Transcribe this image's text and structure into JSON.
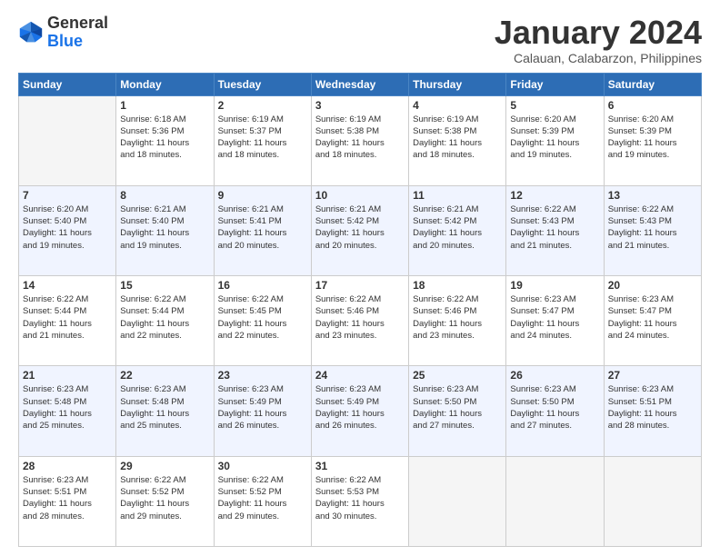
{
  "logo": {
    "line1": "General",
    "line2": "Blue"
  },
  "title": "January 2024",
  "subtitle": "Calauan, Calabarzon, Philippines",
  "days_of_week": [
    "Sunday",
    "Monday",
    "Tuesday",
    "Wednesday",
    "Thursday",
    "Friday",
    "Saturday"
  ],
  "weeks": [
    [
      {
        "num": "",
        "sunrise": "",
        "sunset": "",
        "daylight": ""
      },
      {
        "num": "1",
        "sunrise": "Sunrise: 6:18 AM",
        "sunset": "Sunset: 5:36 PM",
        "daylight": "Daylight: 11 hours and 18 minutes."
      },
      {
        "num": "2",
        "sunrise": "Sunrise: 6:19 AM",
        "sunset": "Sunset: 5:37 PM",
        "daylight": "Daylight: 11 hours and 18 minutes."
      },
      {
        "num": "3",
        "sunrise": "Sunrise: 6:19 AM",
        "sunset": "Sunset: 5:38 PM",
        "daylight": "Daylight: 11 hours and 18 minutes."
      },
      {
        "num": "4",
        "sunrise": "Sunrise: 6:19 AM",
        "sunset": "Sunset: 5:38 PM",
        "daylight": "Daylight: 11 hours and 18 minutes."
      },
      {
        "num": "5",
        "sunrise": "Sunrise: 6:20 AM",
        "sunset": "Sunset: 5:39 PM",
        "daylight": "Daylight: 11 hours and 19 minutes."
      },
      {
        "num": "6",
        "sunrise": "Sunrise: 6:20 AM",
        "sunset": "Sunset: 5:39 PM",
        "daylight": "Daylight: 11 hours and 19 minutes."
      }
    ],
    [
      {
        "num": "7",
        "sunrise": "Sunrise: 6:20 AM",
        "sunset": "Sunset: 5:40 PM",
        "daylight": "Daylight: 11 hours and 19 minutes."
      },
      {
        "num": "8",
        "sunrise": "Sunrise: 6:21 AM",
        "sunset": "Sunset: 5:40 PM",
        "daylight": "Daylight: 11 hours and 19 minutes."
      },
      {
        "num": "9",
        "sunrise": "Sunrise: 6:21 AM",
        "sunset": "Sunset: 5:41 PM",
        "daylight": "Daylight: 11 hours and 20 minutes."
      },
      {
        "num": "10",
        "sunrise": "Sunrise: 6:21 AM",
        "sunset": "Sunset: 5:42 PM",
        "daylight": "Daylight: 11 hours and 20 minutes."
      },
      {
        "num": "11",
        "sunrise": "Sunrise: 6:21 AM",
        "sunset": "Sunset: 5:42 PM",
        "daylight": "Daylight: 11 hours and 20 minutes."
      },
      {
        "num": "12",
        "sunrise": "Sunrise: 6:22 AM",
        "sunset": "Sunset: 5:43 PM",
        "daylight": "Daylight: 11 hours and 21 minutes."
      },
      {
        "num": "13",
        "sunrise": "Sunrise: 6:22 AM",
        "sunset": "Sunset: 5:43 PM",
        "daylight": "Daylight: 11 hours and 21 minutes."
      }
    ],
    [
      {
        "num": "14",
        "sunrise": "Sunrise: 6:22 AM",
        "sunset": "Sunset: 5:44 PM",
        "daylight": "Daylight: 11 hours and 21 minutes."
      },
      {
        "num": "15",
        "sunrise": "Sunrise: 6:22 AM",
        "sunset": "Sunset: 5:44 PM",
        "daylight": "Daylight: 11 hours and 22 minutes."
      },
      {
        "num": "16",
        "sunrise": "Sunrise: 6:22 AM",
        "sunset": "Sunset: 5:45 PM",
        "daylight": "Daylight: 11 hours and 22 minutes."
      },
      {
        "num": "17",
        "sunrise": "Sunrise: 6:22 AM",
        "sunset": "Sunset: 5:46 PM",
        "daylight": "Daylight: 11 hours and 23 minutes."
      },
      {
        "num": "18",
        "sunrise": "Sunrise: 6:22 AM",
        "sunset": "Sunset: 5:46 PM",
        "daylight": "Daylight: 11 hours and 23 minutes."
      },
      {
        "num": "19",
        "sunrise": "Sunrise: 6:23 AM",
        "sunset": "Sunset: 5:47 PM",
        "daylight": "Daylight: 11 hours and 24 minutes."
      },
      {
        "num": "20",
        "sunrise": "Sunrise: 6:23 AM",
        "sunset": "Sunset: 5:47 PM",
        "daylight": "Daylight: 11 hours and 24 minutes."
      }
    ],
    [
      {
        "num": "21",
        "sunrise": "Sunrise: 6:23 AM",
        "sunset": "Sunset: 5:48 PM",
        "daylight": "Daylight: 11 hours and 25 minutes."
      },
      {
        "num": "22",
        "sunrise": "Sunrise: 6:23 AM",
        "sunset": "Sunset: 5:48 PM",
        "daylight": "Daylight: 11 hours and 25 minutes."
      },
      {
        "num": "23",
        "sunrise": "Sunrise: 6:23 AM",
        "sunset": "Sunset: 5:49 PM",
        "daylight": "Daylight: 11 hours and 26 minutes."
      },
      {
        "num": "24",
        "sunrise": "Sunrise: 6:23 AM",
        "sunset": "Sunset: 5:49 PM",
        "daylight": "Daylight: 11 hours and 26 minutes."
      },
      {
        "num": "25",
        "sunrise": "Sunrise: 6:23 AM",
        "sunset": "Sunset: 5:50 PM",
        "daylight": "Daylight: 11 hours and 27 minutes."
      },
      {
        "num": "26",
        "sunrise": "Sunrise: 6:23 AM",
        "sunset": "Sunset: 5:50 PM",
        "daylight": "Daylight: 11 hours and 27 minutes."
      },
      {
        "num": "27",
        "sunrise": "Sunrise: 6:23 AM",
        "sunset": "Sunset: 5:51 PM",
        "daylight": "Daylight: 11 hours and 28 minutes."
      }
    ],
    [
      {
        "num": "28",
        "sunrise": "Sunrise: 6:23 AM",
        "sunset": "Sunset: 5:51 PM",
        "daylight": "Daylight: 11 hours and 28 minutes."
      },
      {
        "num": "29",
        "sunrise": "Sunrise: 6:22 AM",
        "sunset": "Sunset: 5:52 PM",
        "daylight": "Daylight: 11 hours and 29 minutes."
      },
      {
        "num": "30",
        "sunrise": "Sunrise: 6:22 AM",
        "sunset": "Sunset: 5:52 PM",
        "daylight": "Daylight: 11 hours and 29 minutes."
      },
      {
        "num": "31",
        "sunrise": "Sunrise: 6:22 AM",
        "sunset": "Sunset: 5:53 PM",
        "daylight": "Daylight: 11 hours and 30 minutes."
      },
      {
        "num": "",
        "sunrise": "",
        "sunset": "",
        "daylight": ""
      },
      {
        "num": "",
        "sunrise": "",
        "sunset": "",
        "daylight": ""
      },
      {
        "num": "",
        "sunrise": "",
        "sunset": "",
        "daylight": ""
      }
    ]
  ]
}
